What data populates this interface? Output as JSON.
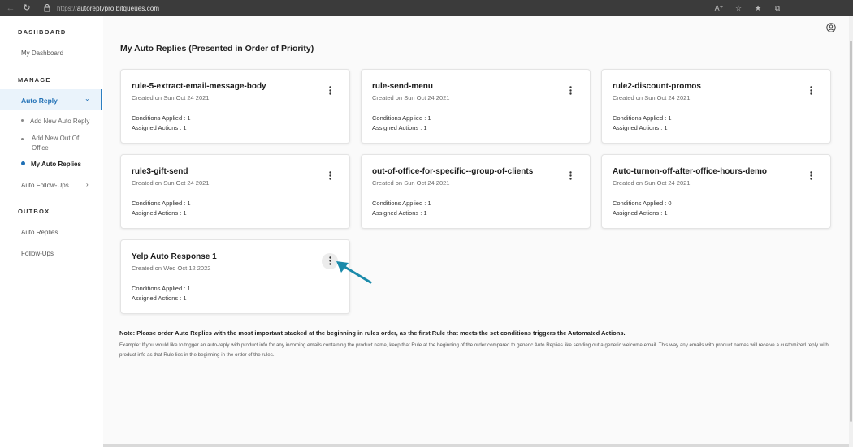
{
  "browser": {
    "url_scheme": "https://",
    "url_host": "autoreplypro.bitqueues.com"
  },
  "sidebar": {
    "dashboard_heading": "DASHBOARD",
    "my_dashboard": "My Dashboard",
    "manage_heading": "MANAGE",
    "auto_reply": "Auto Reply",
    "add_new_auto_reply": "Add New Auto Reply",
    "add_new_out_of_office": "Add New Out Of Office",
    "my_auto_replies": "My Auto Replies",
    "auto_follow_ups": "Auto Follow-Ups",
    "outbox_heading": "OUTBOX",
    "outbox_auto_replies": "Auto Replies",
    "outbox_follow_ups": "Follow-Ups"
  },
  "main": {
    "title": "My Auto Replies (Presented in Order of Priority)",
    "cards": [
      {
        "title": "rule-5-extract-email-message-body",
        "created": "Created on Sun Oct 24 2021",
        "conditions": "Conditions Applied : 1",
        "actions": "Assigned Actions : 1"
      },
      {
        "title": "rule-send-menu",
        "created": "Created on Sun Oct 24 2021",
        "conditions": "Conditions Applied : 1",
        "actions": "Assigned Actions : 1"
      },
      {
        "title": "rule2-discount-promos",
        "created": "Created on Sun Oct 24 2021",
        "conditions": "Conditions Applied : 1",
        "actions": "Assigned Actions : 1"
      },
      {
        "title": "rule3-gift-send",
        "created": "Created on Sun Oct 24 2021",
        "conditions": "Conditions Applied : 1",
        "actions": "Assigned Actions : 1"
      },
      {
        "title": "out-of-office-for-specific--group-of-clients",
        "created": "Created on Sun Oct 24 2021",
        "conditions": "Conditions Applied : 1",
        "actions": "Assigned Actions : 1"
      },
      {
        "title": "Auto-turnon-off-after-office-hours-demo",
        "created": "Created on Sun Oct 24 2021",
        "conditions": "Conditions Applied : 0",
        "actions": "Assigned Actions : 1"
      },
      {
        "title": "Yelp Auto Response 1",
        "created": "Created on Wed Oct 12 2022",
        "conditions": "Conditions Applied : 1",
        "actions": "Assigned Actions : 1"
      }
    ],
    "note": "Note: Please order Auto Replies with the most important stacked at the beginning in rules order, as the first Rule that meets the set conditions triggers the Automated Actions.",
    "example": "Example: If you would like to trigger an auto-reply with product info for any incoming emails containing the product name, keep that Rule at the beginning of the order compared to generic Auto Replies like sending out a generic welcome email. This way any emails with product names will receive a customized reply with product info as that Rule lies in the beginning in the order of the rules."
  },
  "colors": {
    "accent": "#1f6fb5",
    "arrow": "#1a8aaa"
  }
}
